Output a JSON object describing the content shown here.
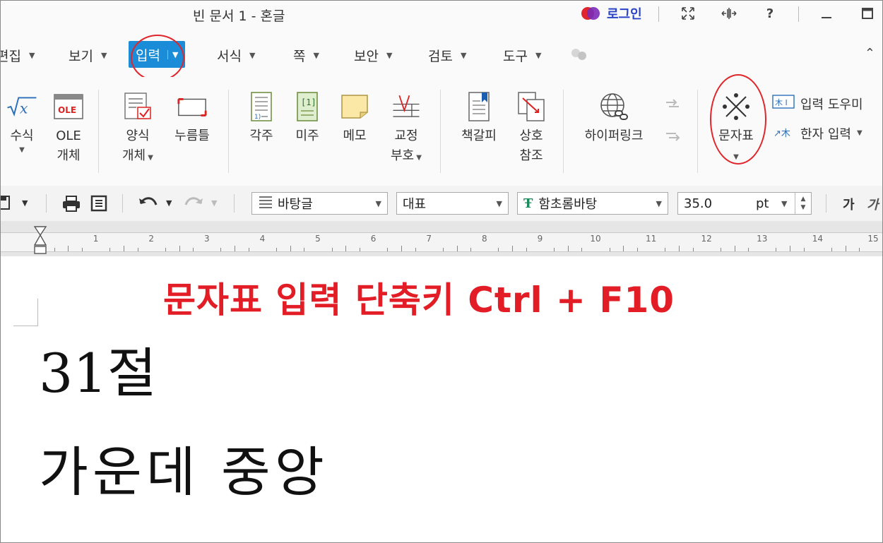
{
  "window": {
    "title": "빈 문서 1 - 혼글",
    "login_label": "로그인"
  },
  "menu": {
    "items": [
      {
        "label": "편집",
        "active": false
      },
      {
        "label": "보기",
        "active": false
      },
      {
        "label": "입력",
        "active": true
      },
      {
        "label": "서식",
        "active": false
      },
      {
        "label": "쪽",
        "active": false
      },
      {
        "label": "보안",
        "active": false
      },
      {
        "label": "검토",
        "active": false
      },
      {
        "label": "도구",
        "active": false
      }
    ]
  },
  "ribbon": {
    "equation": {
      "label": "수식"
    },
    "ole": {
      "label1": "OLE",
      "label2": "개체",
      "icon_text": "OLE"
    },
    "form": {
      "label1": "양식",
      "label2": "개체"
    },
    "press": {
      "label": "누름틀"
    },
    "footnote": {
      "label": "각주"
    },
    "endnote": {
      "label": "미주"
    },
    "memo": {
      "label": "메모"
    },
    "proof": {
      "label1": "교정",
      "label2": "부호"
    },
    "bookmark": {
      "label": "책갈피"
    },
    "crossref": {
      "label1": "상호",
      "label2": "참조"
    },
    "hyperlink": {
      "label": "하이퍼링크"
    },
    "charmap": {
      "label": "문자표"
    },
    "input_helper": {
      "label": "입력 도우미"
    },
    "hanja_input": {
      "label": "한자 입력"
    }
  },
  "format_toolbar": {
    "style": "바탕글",
    "lang": "대표",
    "font": "함초롬바탕",
    "size": "35.0",
    "unit": "pt",
    "char_label": "가",
    "char_label2": "가"
  },
  "ruler": {
    "numbers": [
      "1",
      "2",
      "3",
      "4",
      "5",
      "6",
      "7",
      "8",
      "9",
      "10",
      "11",
      "12",
      "13",
      "14",
      "15"
    ]
  },
  "document": {
    "annotation": "문자표 입력 단축키 Ctrl + F10",
    "line1": "31절",
    "line2": "가운데 중앙"
  },
  "colors": {
    "accent": "#1b8dd8",
    "annotation": "#e21d25"
  }
}
